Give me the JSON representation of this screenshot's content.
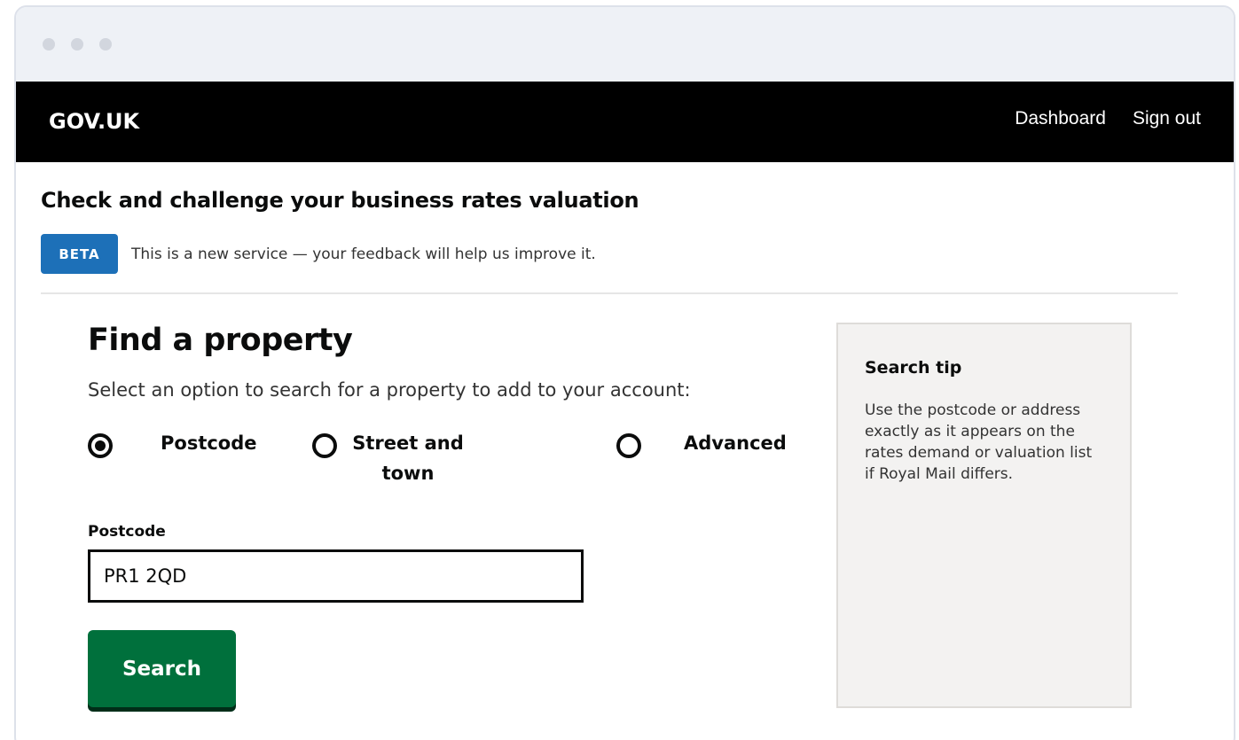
{
  "header": {
    "logo": "GOV.UK",
    "nav": [
      {
        "label": "Dashboard"
      },
      {
        "label": "Sign out"
      }
    ]
  },
  "service": {
    "title": "Check and challenge your business rates valuation",
    "phase_tag": "BETA",
    "phase_text": "This is a new service — your feedback will help us improve it."
  },
  "main": {
    "heading": "Find a property",
    "lede": "Select an option to search for a property to add to your account:",
    "search_options": [
      {
        "label": "Postcode",
        "selected": true
      },
      {
        "label": "Street and town",
        "selected": false
      },
      {
        "label": "Advanced",
        "selected": false
      }
    ],
    "field_label": "Postcode",
    "field_value": "PR1 2QD",
    "button_label": "Search"
  },
  "aside": {
    "title": "Search tip",
    "body": "Use the postcode or address exactly as it appears on the rates demand or valuation list if Royal Mail differs."
  }
}
